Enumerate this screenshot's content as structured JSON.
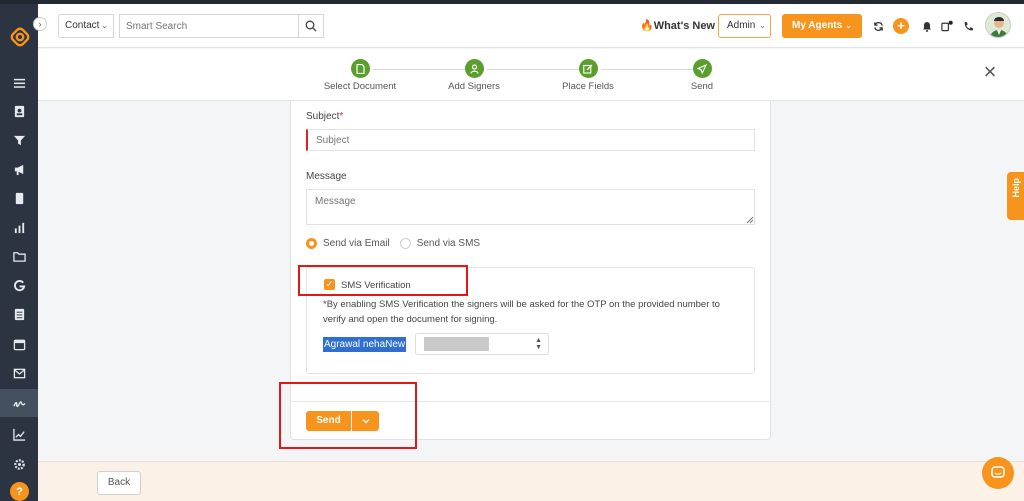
{
  "header": {
    "contact_select": "Contact",
    "search_placeholder": "Smart Search",
    "whats_new": "What's New",
    "admin_select": "Admin",
    "agents_button": "My Agents"
  },
  "stepper": {
    "steps": [
      {
        "label": "Select Document",
        "icon": "document-icon"
      },
      {
        "label": "Add Signers",
        "icon": "user-icon"
      },
      {
        "label": "Place Fields",
        "icon": "edit-icon"
      },
      {
        "label": "Send",
        "icon": "send-icon"
      }
    ]
  },
  "form": {
    "subject_label": "Subject",
    "subject_required": "*",
    "subject_placeholder": "Subject",
    "message_label": "Message",
    "message_placeholder": "Message",
    "radio_email": "Send via Email",
    "radio_sms": "Send via SMS",
    "selected_channel": "email",
    "sms_verification_label": "SMS Verification",
    "sms_verification_checked": true,
    "sms_note": "*By enabling SMS Verification the signers will be asked for the OTP on the provided number to verify and open the document for signing.",
    "signer_name": "Agrawal nehaNew",
    "send_button": "Send"
  },
  "footer": {
    "back_button": "Back"
  },
  "help_tab": "Help",
  "colors": {
    "accent": "#f7941d",
    "sidebar": "#2b3440",
    "step_done": "#5a9e2c",
    "highlight": "#e01818"
  }
}
